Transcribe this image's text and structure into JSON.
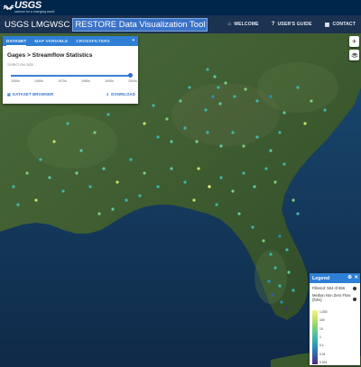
{
  "usgs": {
    "wordmark": "USGS",
    "tagline": "science for a changing world"
  },
  "app": {
    "title": "USGS LMGWSC",
    "subtitle": "RESTORE Data Visualization Tool"
  },
  "nav": [
    {
      "icon": "home-icon",
      "label": "WELCOME"
    },
    {
      "icon": "help-icon",
      "label": "USER'S GUIDE"
    },
    {
      "icon": "contact-icon",
      "label": "CONTACT"
    }
  ],
  "panel": {
    "tabs": [
      {
        "label": "DATASET",
        "active": true
      },
      {
        "label": "MAP VARIABLE",
        "active": false
      },
      {
        "label": "CROSSFILTERS",
        "active": false
      }
    ],
    "heading": "Gages > Streamflow Statistics",
    "decade_placeholder": "Select decade...",
    "slider_value_fraction": 1.0,
    "ticks": [
      "1950s",
      "1960s",
      "1970s",
      "1980s",
      "1990s",
      "2000s"
    ],
    "buttons": {
      "browser": "DATASET BROWSER",
      "download": "DOWNLOAD"
    }
  },
  "zoom": {
    "label": "+"
  },
  "legend": {
    "title": "Legend",
    "filtered": "Filtered: 564 of 656",
    "variable": "Median Non Zero Flow (ft3/s)",
    "scale_labels": [
      "1,000",
      "100",
      "10",
      "1",
      "0.1",
      "0.01",
      "0.001"
    ],
    "colors": [
      "#f5f58a",
      "#7bcf7c",
      "#3fb7a8",
      "#2a90b7",
      "#4b2b7f"
    ]
  },
  "map": {
    "land_color": "#3c5a2e",
    "water_color": "#12304f"
  }
}
